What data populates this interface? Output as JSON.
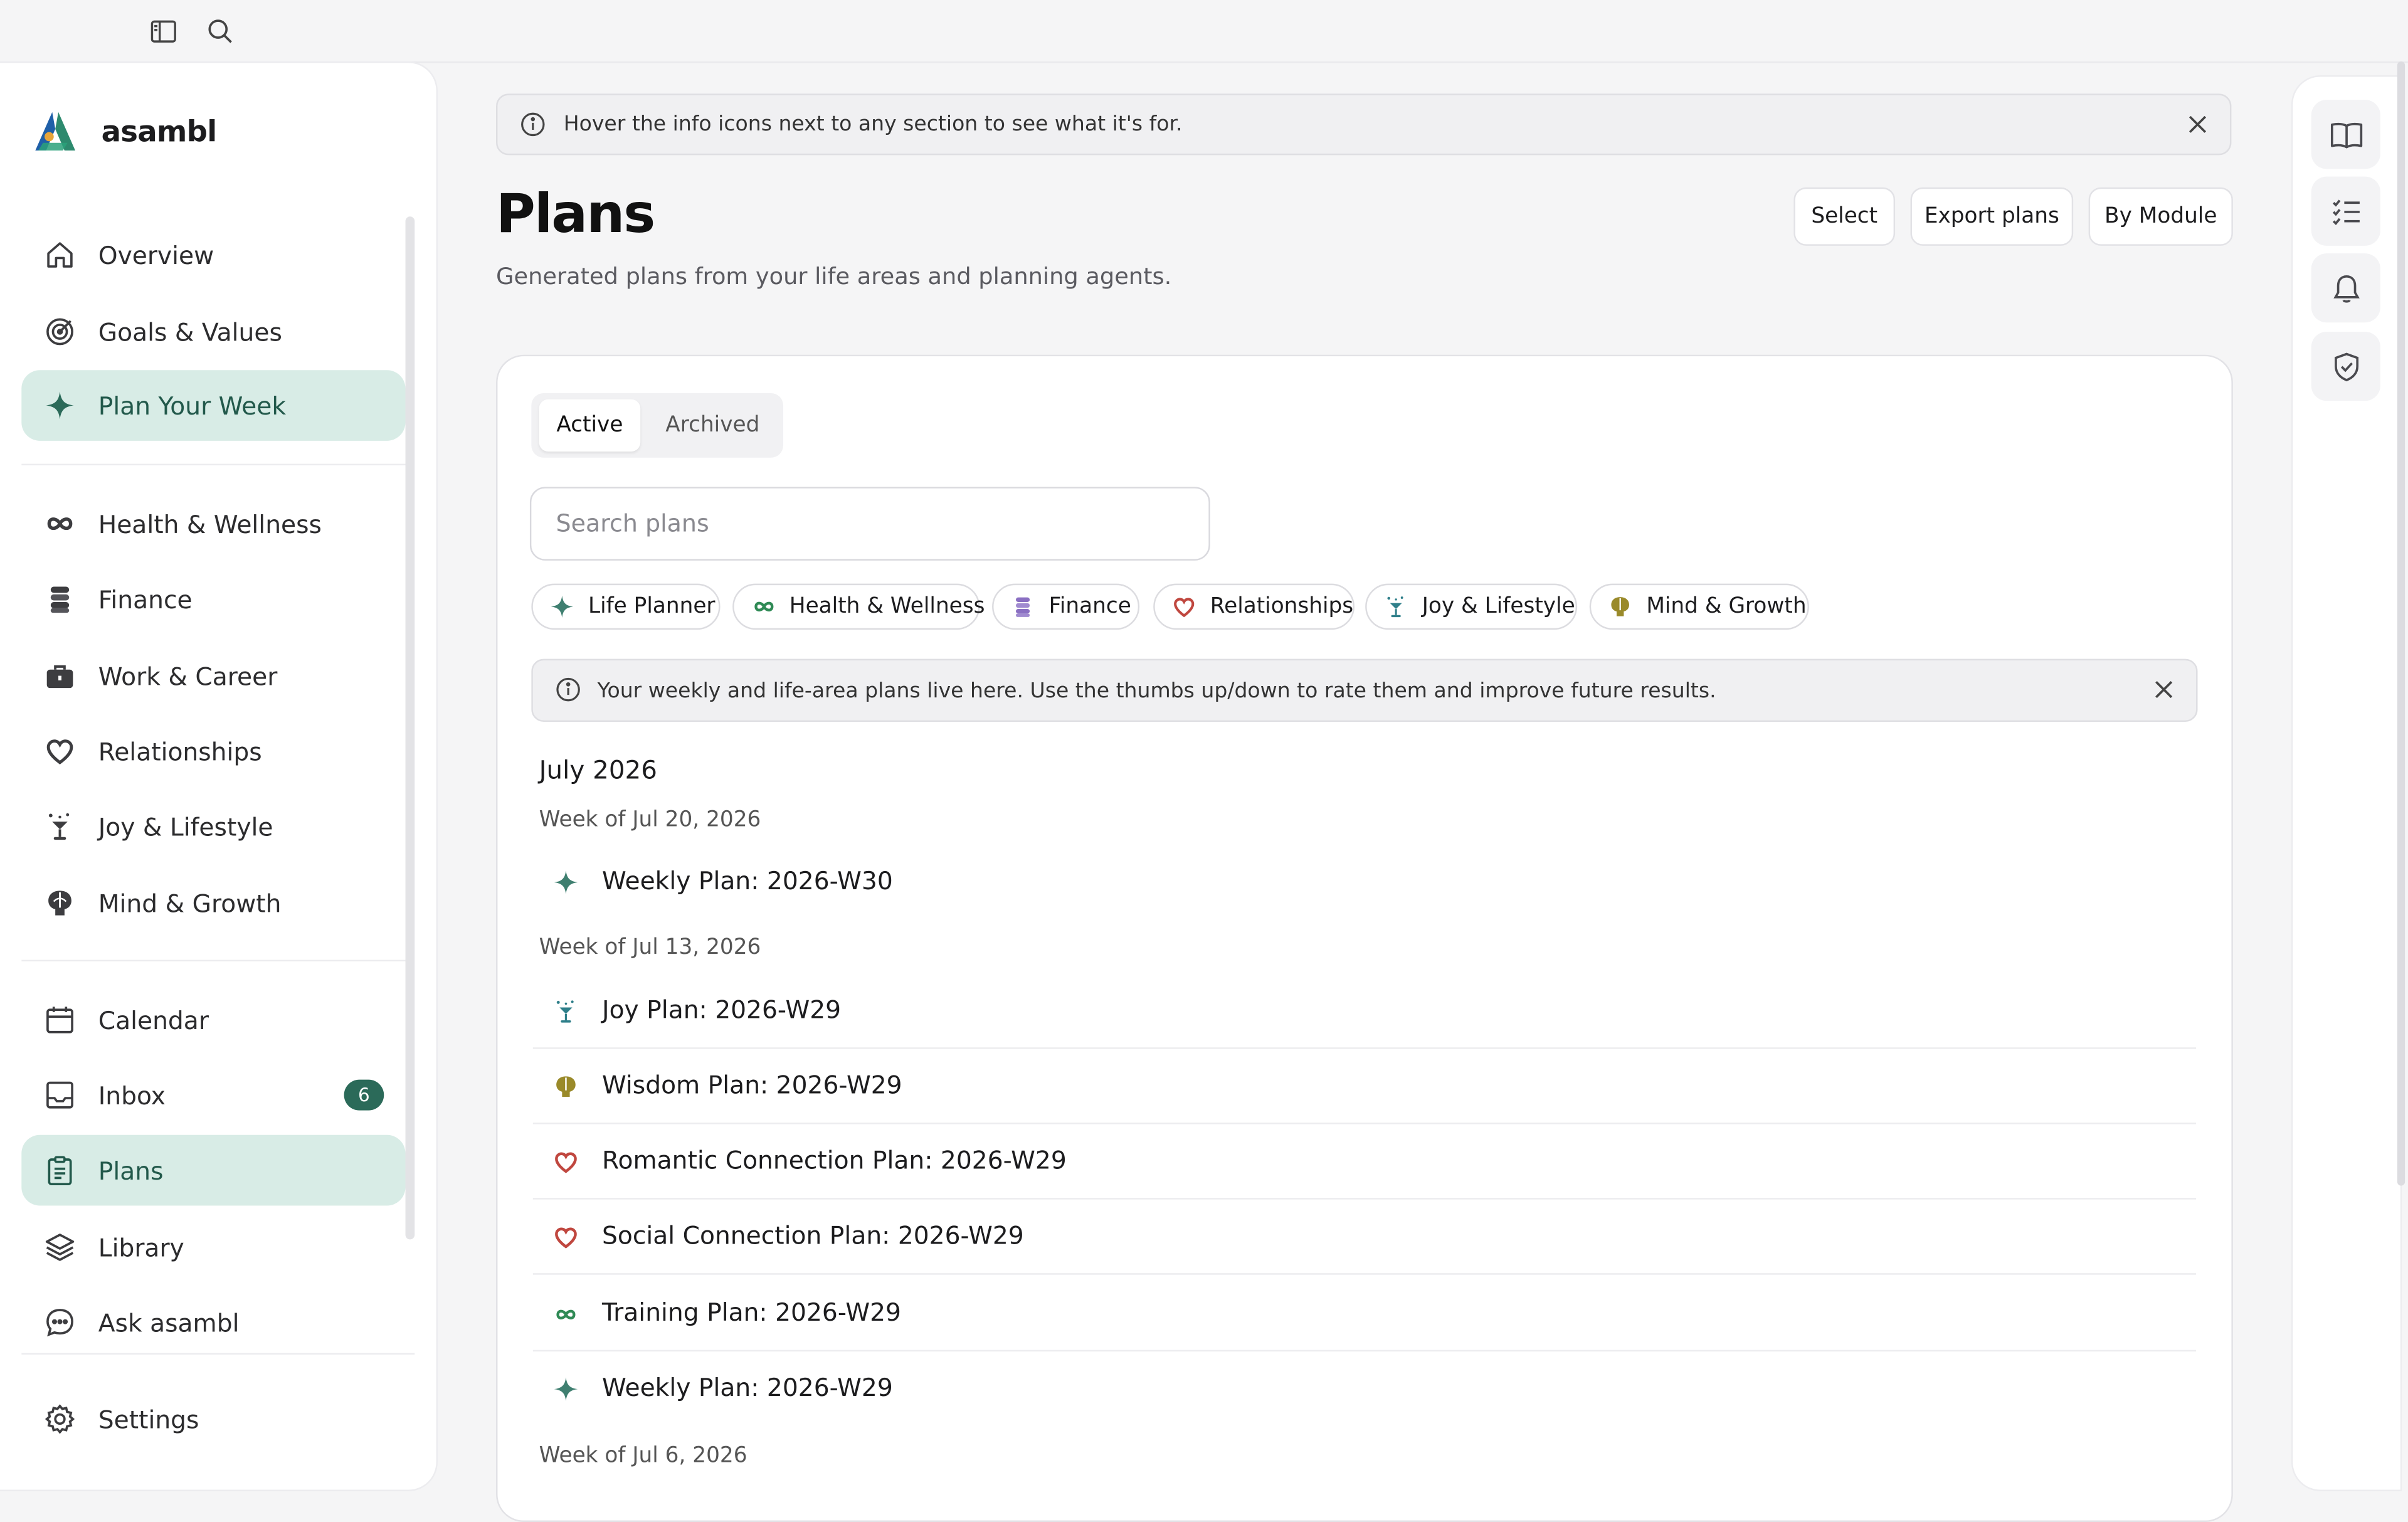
{
  "app": {
    "name": "asambl",
    "accent": "#2b6a59",
    "active_bg": "#d8ece6"
  },
  "topbar": {
    "icons": [
      "sidebar-toggle-icon",
      "search-icon"
    ]
  },
  "sidebar": {
    "primary": [
      {
        "label": "Overview",
        "icon": "home-icon"
      },
      {
        "label": "Goals & Values",
        "icon": "target-icon"
      },
      {
        "label": "Plan Your Week",
        "icon": "sparkle-icon",
        "active": true
      }
    ],
    "areas": [
      {
        "label": "Health & Wellness",
        "icon": "infinity-icon"
      },
      {
        "label": "Finance",
        "icon": "coins-icon"
      },
      {
        "label": "Work & Career",
        "icon": "briefcase-icon"
      },
      {
        "label": "Relationships",
        "icon": "heart-icon"
      },
      {
        "label": "Joy & Lifestyle",
        "icon": "cocktail-icon"
      },
      {
        "label": "Mind & Growth",
        "icon": "brain-icon"
      }
    ],
    "tools": [
      {
        "label": "Calendar",
        "icon": "calendar-icon"
      },
      {
        "label": "Inbox",
        "icon": "inbox-icon",
        "badge": "6"
      },
      {
        "label": "Plans",
        "icon": "clipboard-icon",
        "active": true
      },
      {
        "label": "Library",
        "icon": "layers-icon"
      },
      {
        "label": "Ask asambl",
        "icon": "chat-icon"
      }
    ],
    "settings": {
      "label": "Settings",
      "icon": "gear-icon"
    }
  },
  "banner": {
    "text": "Hover the info icons next to any section to see what it's for."
  },
  "header": {
    "title": "Plans",
    "subtitle": "Generated plans from your life areas and planning agents.",
    "buttons": {
      "select": "Select",
      "export": "Export plans",
      "by_module": "By Module"
    }
  },
  "tabs": {
    "active": "Active",
    "archived": "Archived"
  },
  "search": {
    "placeholder": "Search plans"
  },
  "filters": [
    {
      "label": "Life Planner",
      "icon": "sparkle-icon"
    },
    {
      "label": "Health & Wellness",
      "icon": "infinity-icon"
    },
    {
      "label": "Finance",
      "icon": "coins-icon"
    },
    {
      "label": "Relationships",
      "icon": "heart-icon"
    },
    {
      "label": "Joy & Lifestyle",
      "icon": "cocktail-icon"
    },
    {
      "label": "Mind & Growth",
      "icon": "brain-icon"
    }
  ],
  "info_banner": {
    "text": "Your weekly and life-area plans live here. Use the thumbs up/down to rate them and improve future results."
  },
  "plans": {
    "month": "July 2026",
    "weeks": [
      {
        "label": "Week of Jul 20, 2026",
        "items": [
          {
            "title": "Weekly Plan: 2026-W30",
            "icon": "sparkle-icon"
          }
        ]
      },
      {
        "label": "Week of Jul 13, 2026",
        "items": [
          {
            "title": "Joy Plan: 2026-W29",
            "icon": "cocktail-icon"
          },
          {
            "title": "Wisdom Plan: 2026-W29",
            "icon": "brain-icon"
          },
          {
            "title": "Romantic Connection Plan: 2026-W29",
            "icon": "heart-icon"
          },
          {
            "title": "Social Connection Plan: 2026-W29",
            "icon": "heart-icon"
          },
          {
            "title": "Training Plan: 2026-W29",
            "icon": "infinity-icon"
          },
          {
            "title": "Weekly Plan: 2026-W29",
            "icon": "sparkle-icon"
          }
        ]
      },
      {
        "label": "Week of Jul 6, 2026",
        "items": []
      }
    ]
  },
  "right_rail": {
    "icons": [
      "book-icon",
      "checklist-icon",
      "bell-icon",
      "shield-check-icon"
    ]
  }
}
